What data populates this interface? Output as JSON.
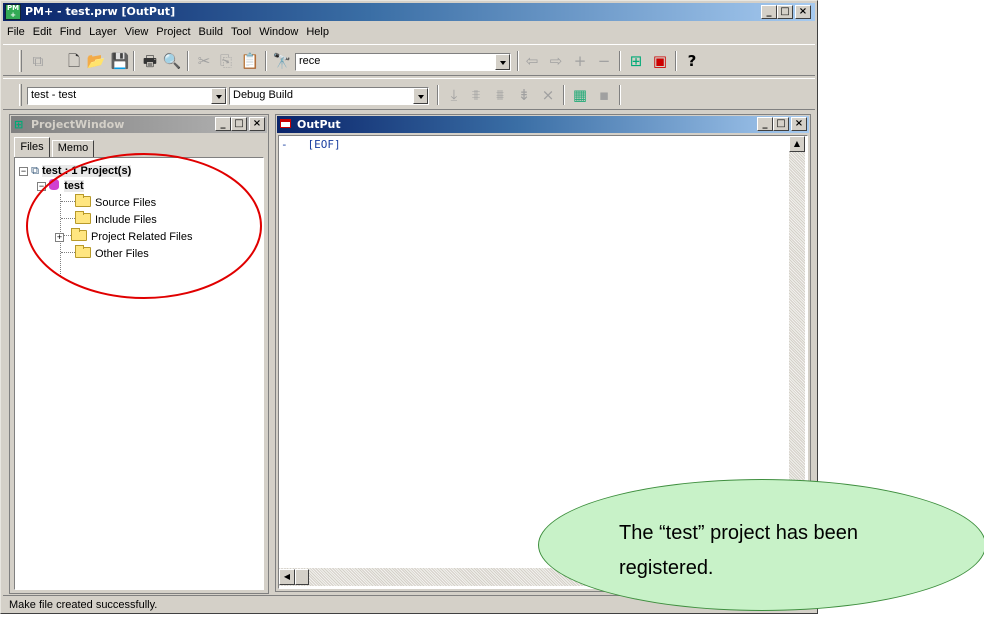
{
  "window": {
    "title": "PM+ - test.prw [OutPut]",
    "caption_buttons": [
      "_",
      "□",
      "×"
    ]
  },
  "menu": [
    "File",
    "Edit",
    "Find",
    "Layer",
    "View",
    "Project",
    "Build",
    "Tool",
    "Window",
    "Help"
  ],
  "toolbar": {
    "search_value": "rece",
    "project_combo": "test - test",
    "build_combo": "Debug Build"
  },
  "project_window": {
    "title": "ProjectWindow",
    "tabs": [
      "Files",
      "Memo"
    ],
    "tree": {
      "root": "test : 1 Project(s)",
      "project": "test",
      "folders": [
        "Source Files",
        "Include Files",
        "Project Related Files",
        "Other Files"
      ]
    }
  },
  "output_window": {
    "title": "OutPut",
    "lines": [
      "-   [EOF]"
    ]
  },
  "status_bar": {
    "text": "Make file created successfully."
  },
  "callout": {
    "text": "The “test” project has been registered.",
    "color": "#c8f2c8"
  },
  "annotation": {
    "circle_color": "#e00000"
  }
}
